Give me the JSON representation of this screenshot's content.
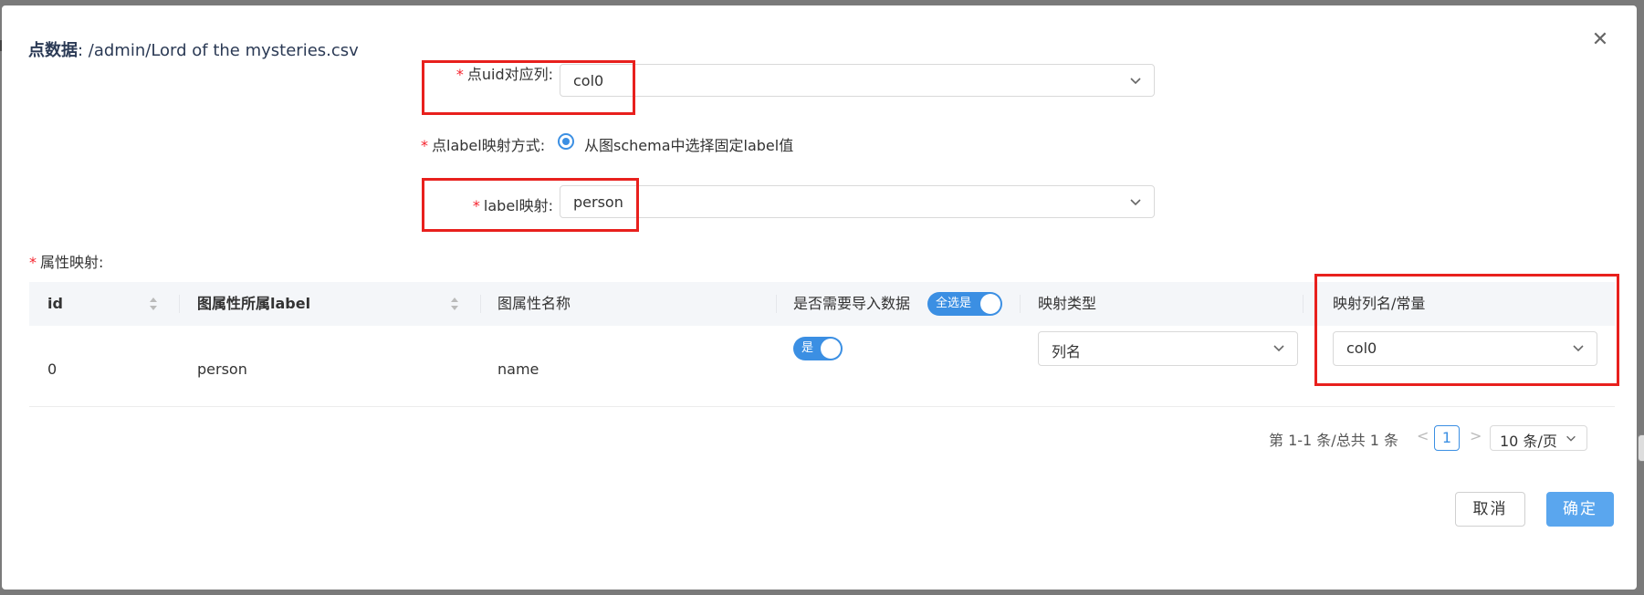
{
  "modal": {
    "title_prefix": "点数据",
    "title_path": ": /admin/Lord of the mysteries.csv",
    "close_icon": "close-icon"
  },
  "form": {
    "uid_label": "点uid对应列:",
    "uid_value": "col0",
    "label_mode_label": "点label映射方式:",
    "label_mode_option": "从图schema中选择固定label值",
    "label_map_label": "label映射:",
    "label_map_value": "person",
    "attr_map_label": "属性映射:",
    "required_mark": "*"
  },
  "table": {
    "columns": [
      "id",
      "图属性所属label",
      "图属性名称",
      "是否需要导入数据",
      "映射类型",
      "映射列名/常量"
    ],
    "select_all_switch": "全选是",
    "rows": [
      {
        "id": "0",
        "label": "person",
        "name": "name",
        "import_switch": "是",
        "map_type": "列名",
        "map_value": "col0"
      }
    ]
  },
  "pagination": {
    "summary": "第 1-1 条/总共 1 条",
    "prev": "<",
    "current": "1",
    "next": ">",
    "page_size": "10 条/页"
  },
  "buttons": {
    "cancel": "取消",
    "ok": "确定"
  },
  "colors": {
    "accent": "#3b8fe3",
    "highlight": "#e8201d",
    "required": "#f5222d"
  }
}
